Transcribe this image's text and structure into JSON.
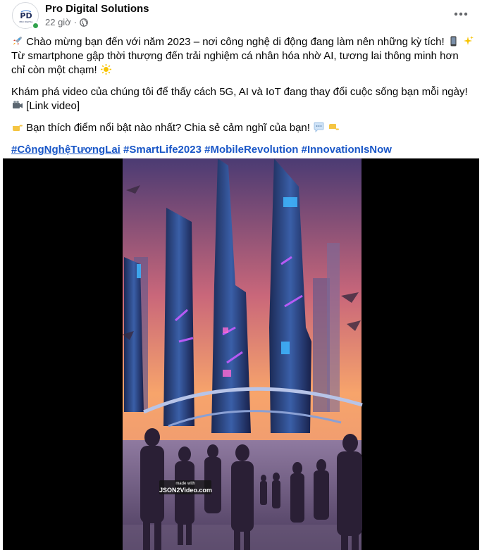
{
  "post": {
    "page_name": "Pro Digital Solutions",
    "time_ago": "22 giờ",
    "separator": "·",
    "visibility_icon": "globe-icon",
    "more_icon": "more-horizontal-icon",
    "avatar_logo_text": "PD",
    "avatar_logo_subtext": "PRO DIGITAL",
    "online_color": "#31a24c"
  },
  "text": {
    "line1_emoji": "rocket-icon",
    "line1": "Chào mừng bạn đến với năm 2023 – nơi công nghệ di động đang làm nên những kỳ tích!",
    "line1_end_emojis": [
      "mobile-phone-icon",
      "sparkles-icon"
    ],
    "line2": "Từ smartphone gập thời thượng đến trải nghiệm cá nhân hóa nhờ AI, tương lai thông minh hơn",
    "line3": "chỉ còn một chạm!",
    "line3_emoji": "glowing-star-icon",
    "para2_line1": "Khám phá video của chúng tôi để thấy cách 5G, AI và IoT đang thay đổi cuộc sống bạn mỗi ngày!",
    "para2_emoji": "video-camera-icon",
    "para2_line2": "[Link video]",
    "para3_emoji": "pointing-right-icon",
    "para3": "Bạn thích điểm nổi bật nào nhất? Chia sẻ cảm nghĩ của bạn!",
    "para3_end_emojis": [
      "speech-bubble-icon",
      "pointing-down-icon"
    ],
    "hashtags": [
      "#CôngNghệTươngLai",
      "#SmartLife2023",
      "#MobileRevolution",
      "#InnovationIsNow"
    ]
  },
  "video": {
    "watermark_small": "made with",
    "watermark_big": "JSON2Video.com",
    "accent_sky": "#f7a46b",
    "accent_neon": "#c45cff"
  }
}
